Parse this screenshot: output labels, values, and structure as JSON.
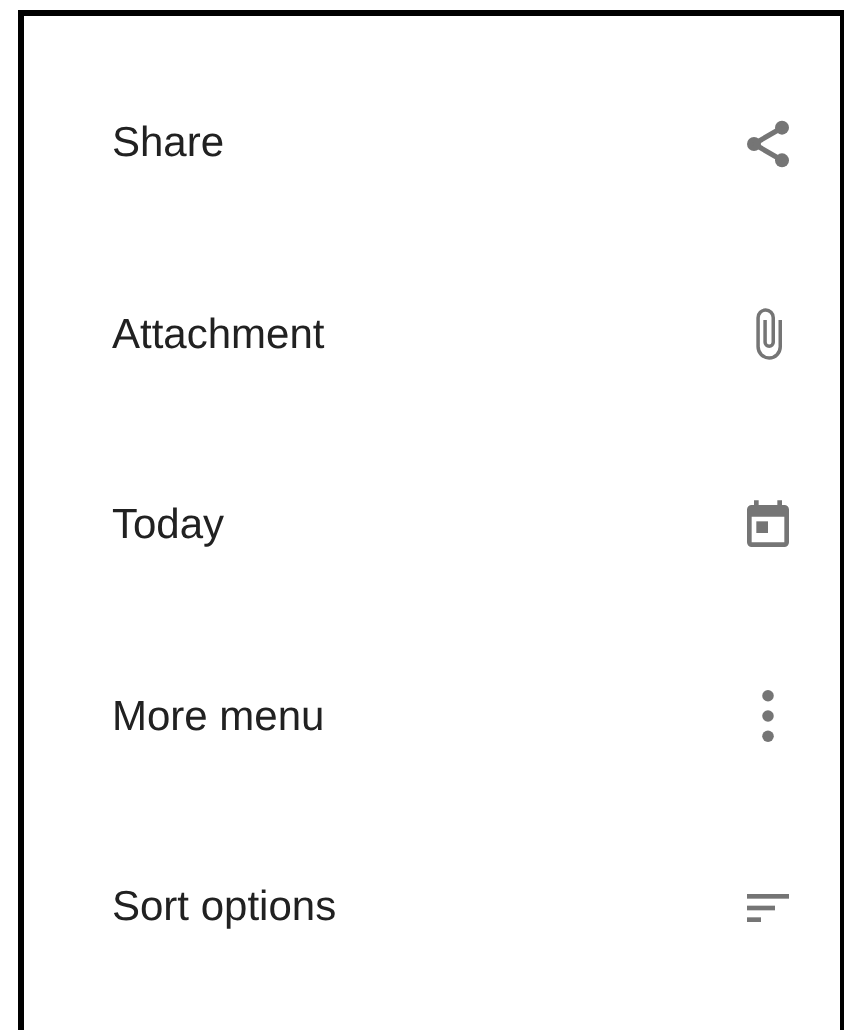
{
  "menu_items": [
    {
      "label": "Share",
      "kind": "share"
    },
    {
      "label": "Attachment",
      "kind": "attachment"
    },
    {
      "label": "Today",
      "kind": "today"
    },
    {
      "label": "More menu",
      "kind": "more"
    },
    {
      "label": "Sort options",
      "kind": "sort"
    }
  ]
}
